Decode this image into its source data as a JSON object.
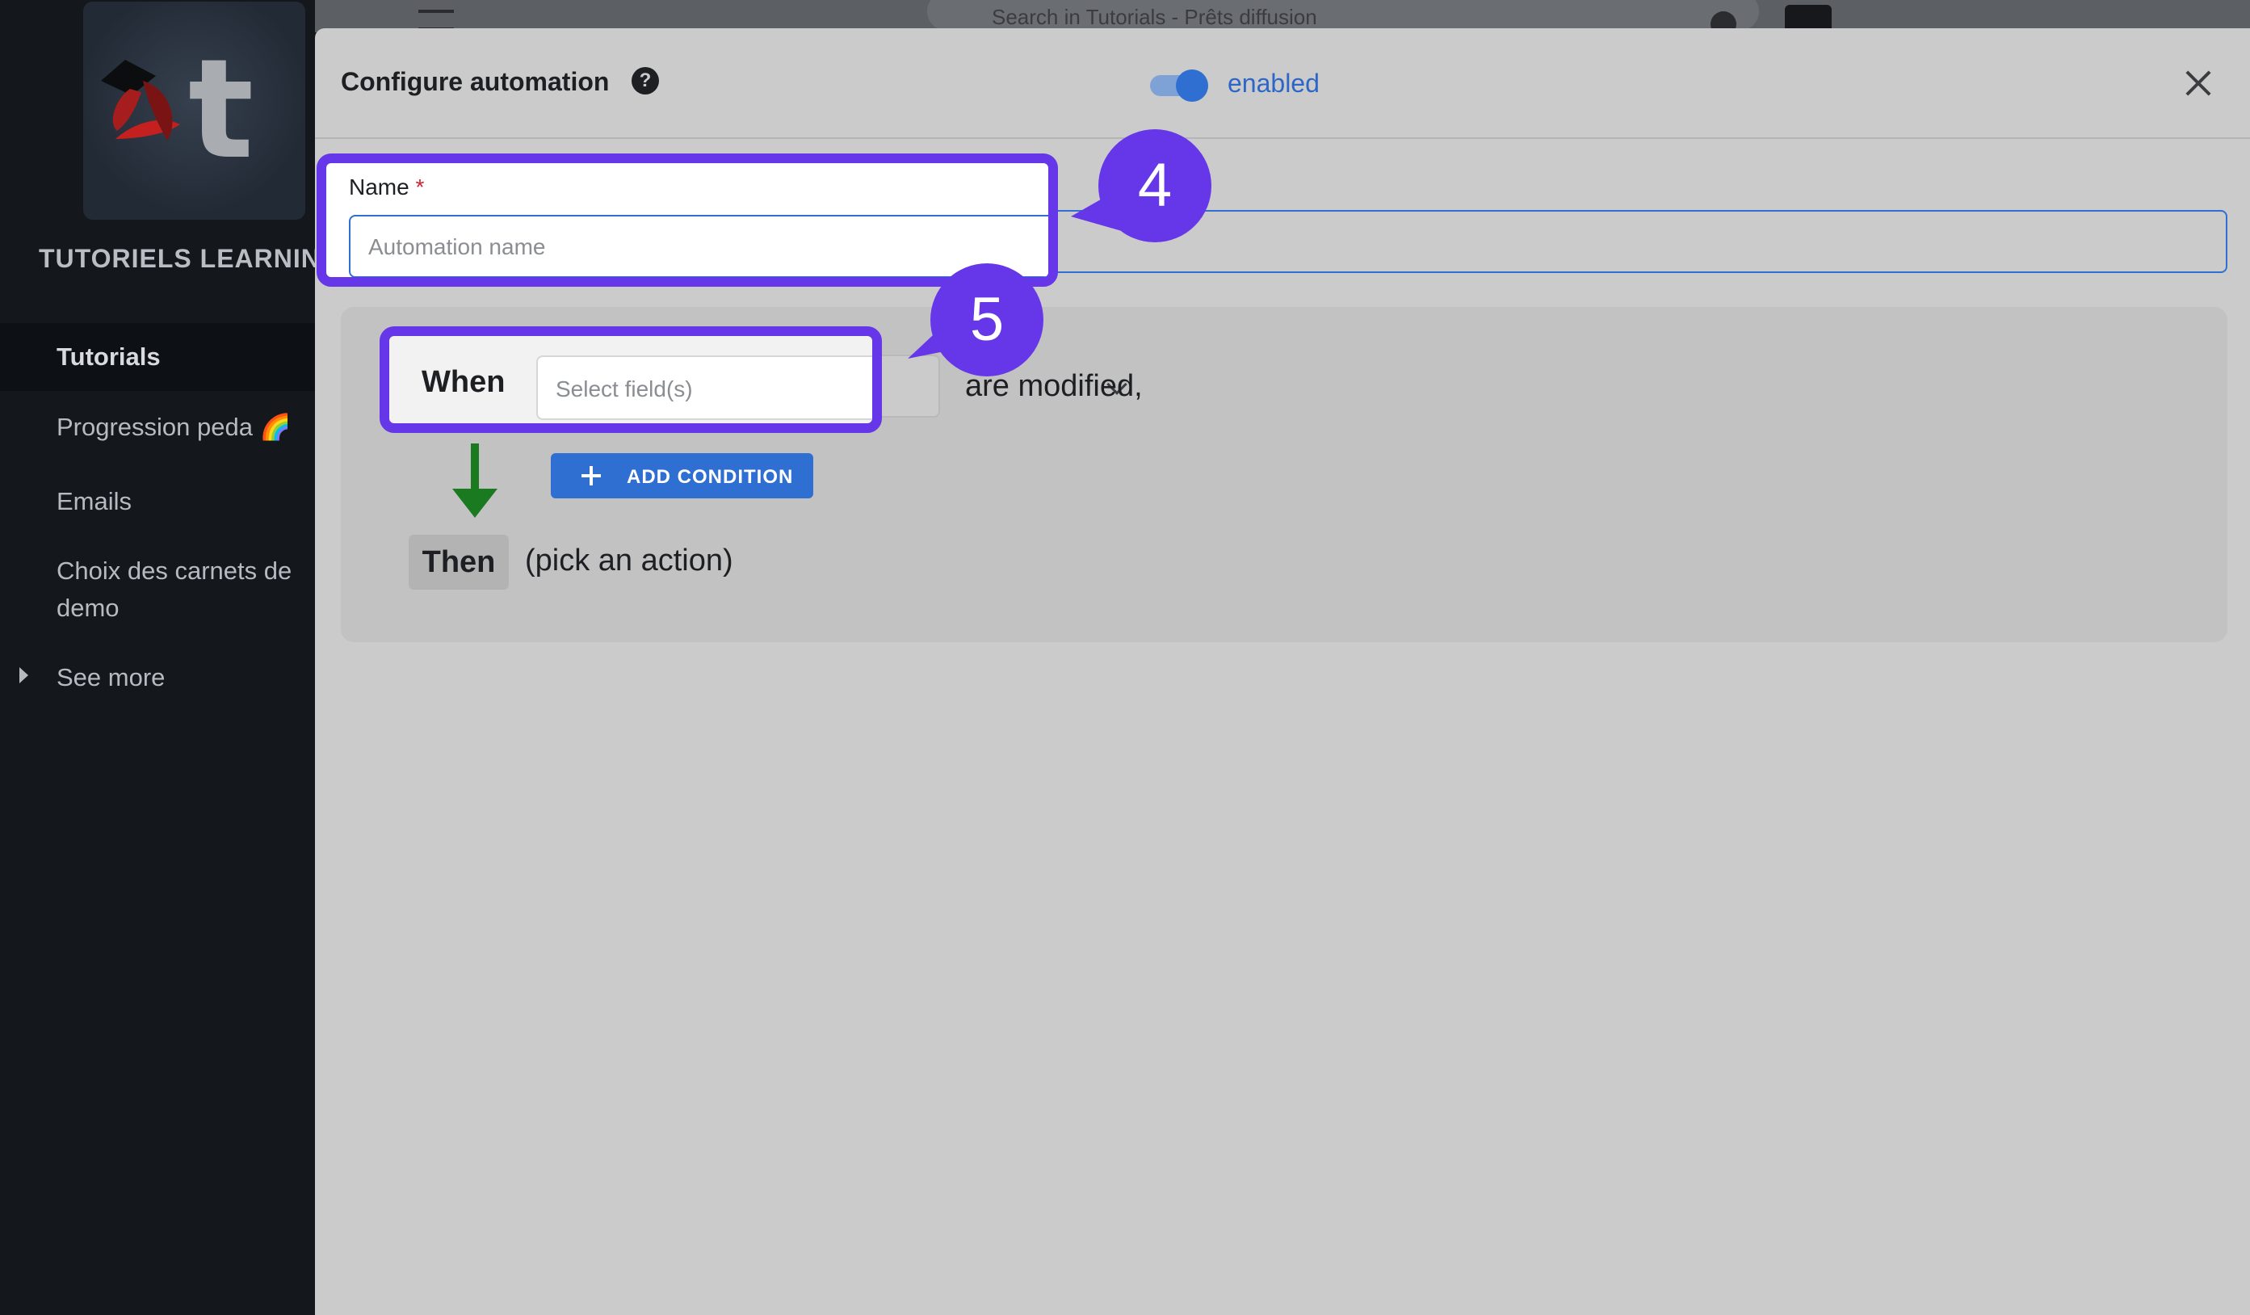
{
  "sidebar": {
    "workspace_name": "TUTORIELS LEARNING",
    "items": [
      {
        "label": "Tutorials",
        "active": true
      },
      {
        "label": "Progression peda 🌈",
        "active": false
      },
      {
        "label": "Emails",
        "active": false
      },
      {
        "label": "Choix des carnets de",
        "label2": "demo",
        "active": false
      },
      {
        "label": "See more",
        "active": false
      }
    ]
  },
  "topbar": {
    "search_placeholder": "Search in Tutorials - Prêts diffusion"
  },
  "modal": {
    "title": "Configure automation",
    "help_icon": "?",
    "toggle_label": "enabled",
    "toggle_on": true,
    "name_label": "Name",
    "required_mark": "*",
    "name_placeholder": "Automation name",
    "when_label": "When",
    "field_placeholder": "Select field(s)",
    "modified_text": "are modified,",
    "add_condition_label": "ADD CONDITION",
    "then_label": "Then",
    "action_text": "(pick an action)"
  },
  "callouts": {
    "step4": "4",
    "step5": "5"
  },
  "colors": {
    "accent": "#2f6fd1",
    "callout": "#6637e8",
    "arrow": "#1a7a1f",
    "sidebar_bg": "#14181d",
    "modal_bg": "#cbcbcb"
  },
  "icons": [
    "graduation-cap-logo",
    "help-icon",
    "close-icon",
    "chevron-down-icon",
    "arrow-down-icon",
    "plus-icon",
    "caret-right-icon",
    "search-icon",
    "gear-icon",
    "hamburger-icon"
  ]
}
